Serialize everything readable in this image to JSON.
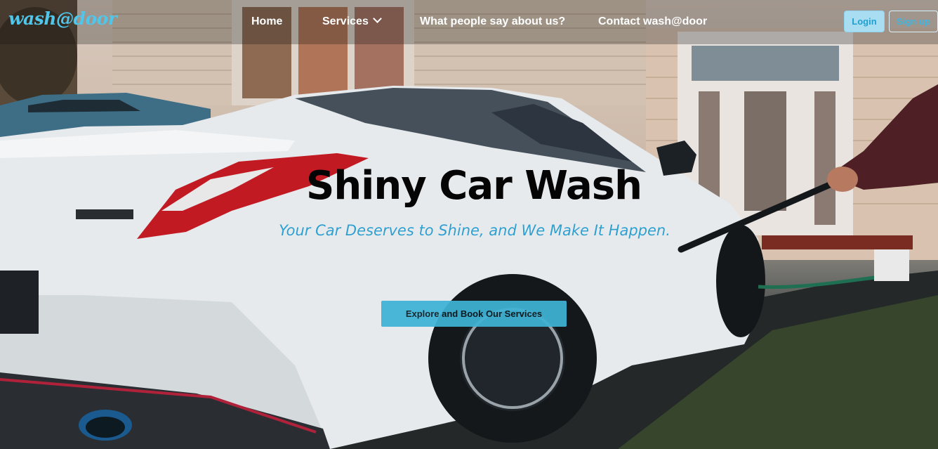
{
  "brand": "wash@door",
  "nav": {
    "home": "Home",
    "services": "Services",
    "testimonials": "What people say about us?",
    "contact": "Contact wash@door"
  },
  "auth": {
    "login": "Login",
    "signup": "Sign up"
  },
  "hero": {
    "title": "Shiny Car Wash",
    "subtitle": "Your Car Deserves to Shine, and We Make It Happen.",
    "cta": "Explore and Book Our Services"
  },
  "colors": {
    "accent": "#4fc6ea",
    "cta_bg": "#3fb3d6",
    "subtitle": "#2f9fd0"
  }
}
